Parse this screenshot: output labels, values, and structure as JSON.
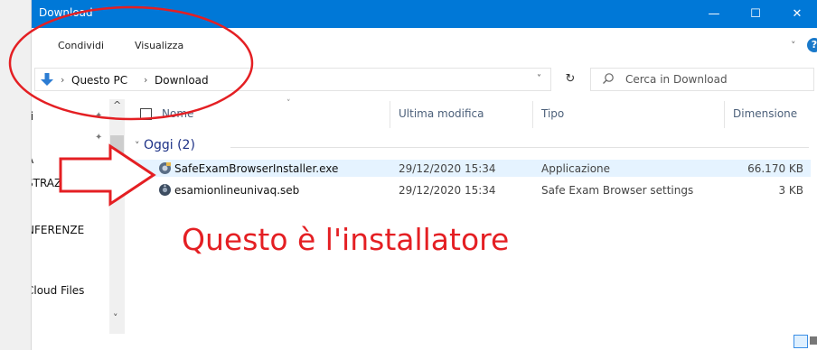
{
  "window": {
    "title": "Download"
  },
  "window_buttons": {
    "minimize": "—",
    "maximize": "☐",
    "close": "✕"
  },
  "ribbon": {
    "tabs": [
      "Condividi",
      "Visualizza"
    ],
    "expand": "˅",
    "help": "?"
  },
  "address": {
    "crumbs": [
      "Questo PC",
      "Download"
    ],
    "separator": "›",
    "dropdown": "˅",
    "refresh": "↻"
  },
  "search": {
    "placeholder": "Cerca in Download"
  },
  "nav": {
    "items": [
      "ti",
      "i",
      "A",
      "STRAZIONE",
      "NFERENZE",
      "Cloud Files"
    ],
    "scroll_up": "^",
    "scroll_down": "˅",
    "pin": "✦"
  },
  "columns": {
    "name": "Nome",
    "modified": "Ultima modifica",
    "type": "Tipo",
    "size": "Dimensione"
  },
  "group": {
    "label": "Oggi (2)"
  },
  "files": [
    {
      "name": "SafeExamBrowserInstaller.exe",
      "modified": "29/12/2020 15:34",
      "type": "Applicazione",
      "size": "66.170 KB",
      "selected": true,
      "icon": "installer-icon"
    },
    {
      "name": "esamionlineunivaq.seb",
      "modified": "29/12/2020 15:34",
      "type": "Safe Exam Browser settings",
      "size": "3 KB",
      "selected": false,
      "icon": "seb-file-icon"
    }
  ],
  "annotation": {
    "text": "Questo è l'installatore",
    "color": "#e41f23"
  },
  "colors": {
    "titlebar": "#0078d7",
    "selection": "#e5f3ff",
    "annotation_red": "#e41f23",
    "group_text": "#1e3287"
  }
}
